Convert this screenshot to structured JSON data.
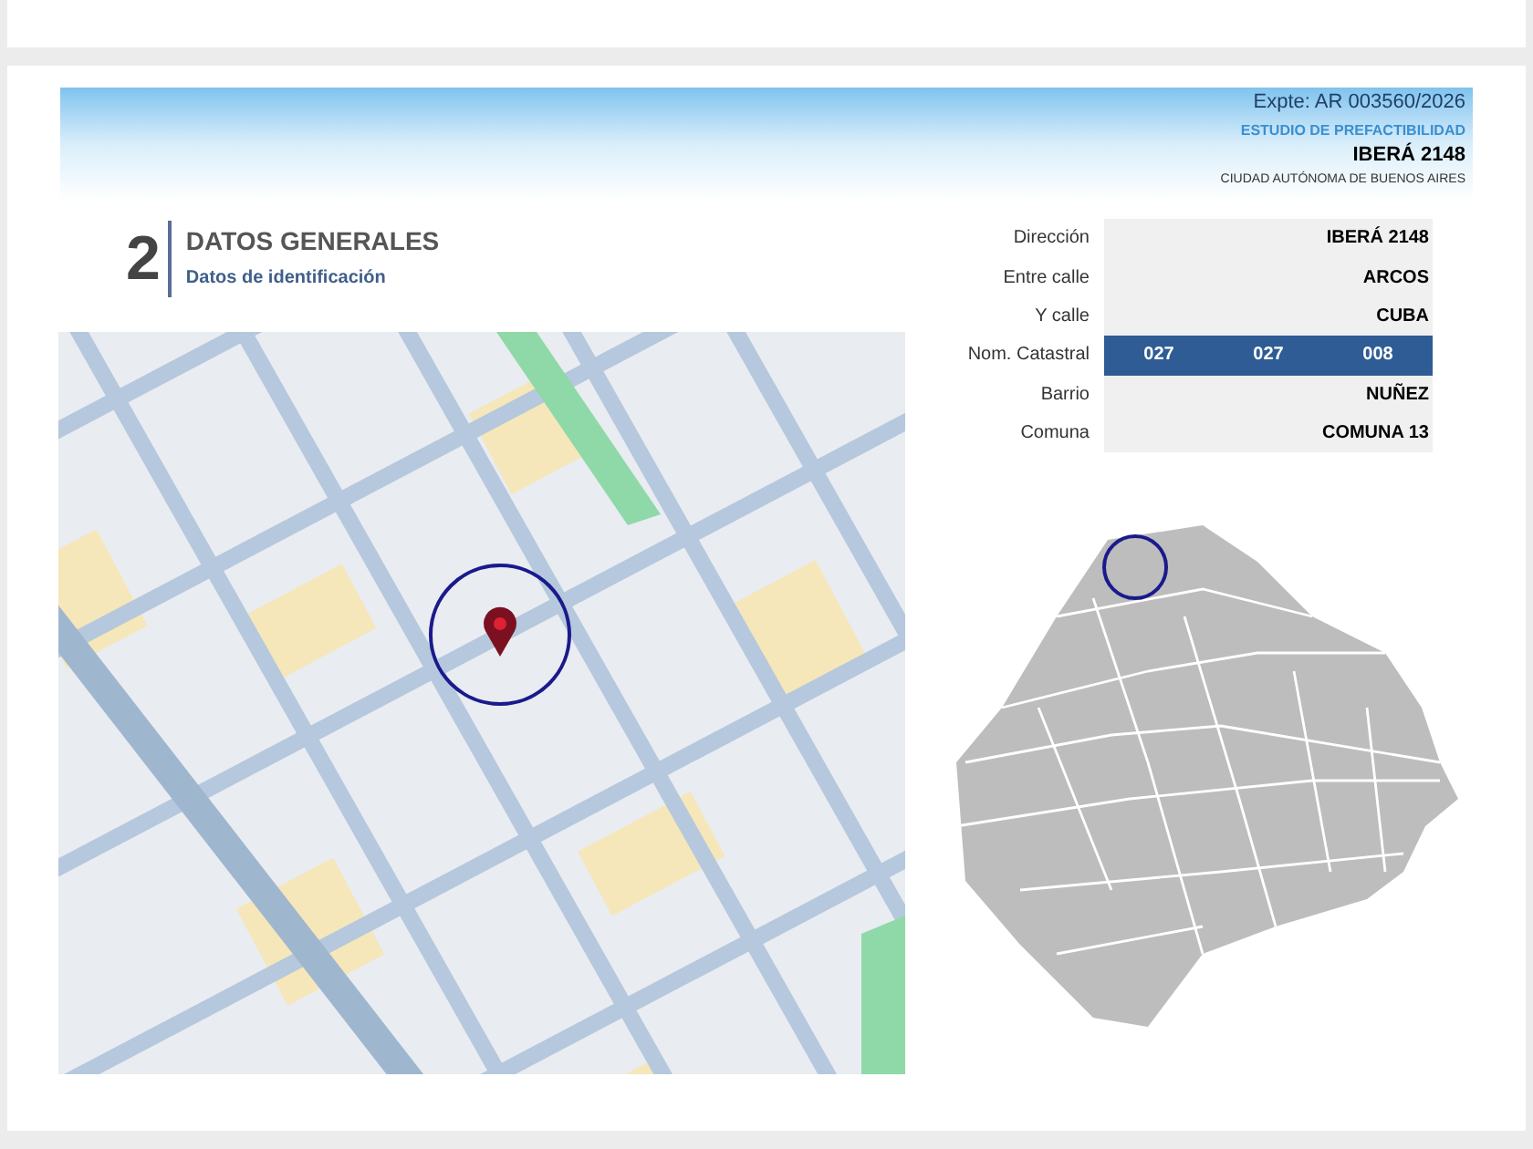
{
  "header": {
    "expediente": "Expte: AR 003560/2026",
    "study": "ESTUDIO DE PREFACTIBILIDAD",
    "address": "IBERÁ 2148",
    "city": "CIUDAD AUTÓNOMA DE BUENOS AIRES"
  },
  "section": {
    "number": "2",
    "title": "DATOS GENERALES",
    "subtitle": "Datos de identificación"
  },
  "details": [
    {
      "label": "Dirección",
      "kind": "text",
      "value": "IBERÁ 2148"
    },
    {
      "label": "Entre calle",
      "kind": "text",
      "value": "ARCOS"
    },
    {
      "label": "Y calle",
      "kind": "text",
      "value": "CUBA"
    },
    {
      "label": "Nom. Catastral",
      "kind": "parts",
      "values": [
        "027",
        "027",
        "008"
      ]
    },
    {
      "label": "Barrio",
      "kind": "text",
      "value": "NUÑEZ"
    },
    {
      "label": "Comuna",
      "kind": "text",
      "value": "COMUNA 13"
    }
  ]
}
